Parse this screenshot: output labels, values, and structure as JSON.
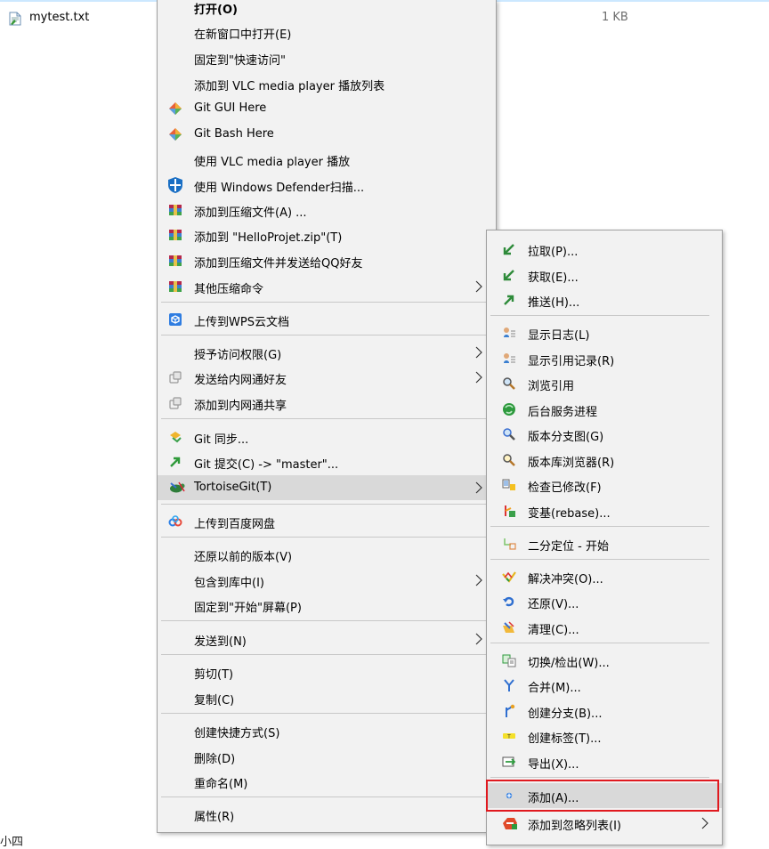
{
  "file": {
    "name": "mytest.txt",
    "size": "1 KB"
  },
  "bottom_text": "小四",
  "main_menu": {
    "items": [
      {
        "label": "打开(O)",
        "icon": ""
      },
      {
        "label": "在新窗口中打开(E)",
        "icon": ""
      },
      {
        "label": "固定到\"快速访问\"",
        "icon": ""
      },
      {
        "label": "添加到 VLC media player 播放列表",
        "icon": ""
      },
      {
        "label": "Git GUI Here",
        "icon": "git-diamond-icon"
      },
      {
        "label": "Git Bash Here",
        "icon": "git-diamond-icon"
      },
      {
        "label": "使用 VLC media player 播放",
        "icon": ""
      },
      {
        "label": "使用 Windows Defender扫描...",
        "icon": "defender-shield-icon"
      },
      {
        "label": "添加到压缩文件(A) ...",
        "icon": "archive-icon"
      },
      {
        "label": "添加到 \"HelloProjet.zip\"(T)",
        "icon": "archive-icon"
      },
      {
        "label": "添加到压缩文件并发送给QQ好友",
        "icon": "archive-icon"
      },
      {
        "label": "其他压缩命令",
        "icon": "archive-icon",
        "has_submenu": true
      },
      {
        "label": "上传到WPS云文档",
        "icon": "wps-cloud-icon"
      },
      {
        "label": "授予访问权限(G)",
        "icon": "",
        "has_submenu": true
      },
      {
        "label": "发送给内网通好友",
        "icon": "intranet-icon",
        "has_submenu": true
      },
      {
        "label": "添加到内网通共享",
        "icon": "intranet-icon"
      },
      {
        "label": "Git 同步...",
        "icon": "git-sync-icon"
      },
      {
        "label": "Git 提交(C) -> \"master\"...",
        "icon": "git-commit-icon"
      },
      {
        "label": "TortoiseGit(T)",
        "icon": "tortoisegit-icon",
        "has_submenu": true
      },
      {
        "label": "上传到百度网盘",
        "icon": "baidu-netdisk-icon"
      },
      {
        "label": "还原以前的版本(V)",
        "icon": ""
      },
      {
        "label": "包含到库中(I)",
        "icon": "",
        "has_submenu": true
      },
      {
        "label": "固定到\"开始\"屏幕(P)",
        "icon": ""
      },
      {
        "label": "发送到(N)",
        "icon": "",
        "has_submenu": true
      },
      {
        "label": "剪切(T)",
        "icon": ""
      },
      {
        "label": "复制(C)",
        "icon": ""
      },
      {
        "label": "创建快捷方式(S)",
        "icon": ""
      },
      {
        "label": "删除(D)",
        "icon": ""
      },
      {
        "label": "重命名(M)",
        "icon": ""
      },
      {
        "label": "属性(R)",
        "icon": ""
      }
    ]
  },
  "sub_menu": {
    "items": [
      {
        "label": "拉取(P)...",
        "icon": "pull-icon"
      },
      {
        "label": "获取(E)...",
        "icon": "fetch-icon"
      },
      {
        "label": "推送(H)...",
        "icon": "push-icon"
      },
      {
        "label": "显示日志(L)",
        "icon": "show-log-icon"
      },
      {
        "label": "显示引用记录(R)",
        "icon": "reflog-icon"
      },
      {
        "label": "浏览引用",
        "icon": "browse-refs-icon"
      },
      {
        "label": "后台服务进程",
        "icon": "daemon-icon"
      },
      {
        "label": "版本分支图(G)",
        "icon": "revision-graph-icon"
      },
      {
        "label": "版本库浏览器(R)",
        "icon": "repo-browser-icon"
      },
      {
        "label": "检查已修改(F)",
        "icon": "check-modifications-icon"
      },
      {
        "label": "变基(rebase)...",
        "icon": "rebase-icon"
      },
      {
        "label": "二分定位 - 开始",
        "icon": "bisect-icon"
      },
      {
        "label": "解决冲突(O)...",
        "icon": "resolve-icon"
      },
      {
        "label": "还原(V)...",
        "icon": "revert-icon"
      },
      {
        "label": "清理(C)...",
        "icon": "cleanup-icon"
      },
      {
        "label": "切换/检出(W)...",
        "icon": "switch-checkout-icon"
      },
      {
        "label": "合并(M)...",
        "icon": "merge-icon"
      },
      {
        "label": "创建分支(B)...",
        "icon": "create-branch-icon"
      },
      {
        "label": "创建标签(T)...",
        "icon": "create-tag-icon"
      },
      {
        "label": "导出(X)...",
        "icon": "export-icon"
      },
      {
        "label": "添加(A)...",
        "icon": "add-icon"
      },
      {
        "label": "添加到忽略列表(I)",
        "icon": "ignore-icon",
        "has_submenu": true
      }
    ]
  },
  "colors": {
    "menu_bg": "#f2f2f2",
    "hover_bg": "#d9d9d9",
    "highlight_border": "#e0191f",
    "selection_line": "#cce8ff"
  }
}
